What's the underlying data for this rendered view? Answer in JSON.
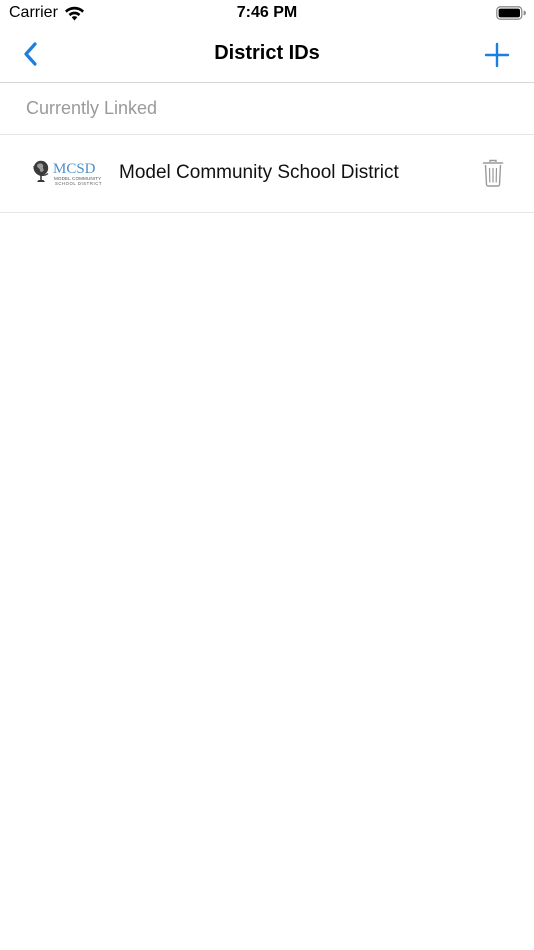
{
  "status_bar": {
    "carrier": "Carrier",
    "time": "7:46 PM",
    "wifi_icon": "wifi-icon",
    "battery_icon": "battery-icon"
  },
  "nav": {
    "title": "District IDs",
    "back_icon": "chevron-left-icon",
    "add_icon": "plus-icon"
  },
  "section": {
    "header": "Currently Linked"
  },
  "districts": [
    {
      "name": "Model Community School District",
      "logo": {
        "abbreviation": "MCSD",
        "line1": "MODEL COMMUNITY",
        "line2": "SCHOOL DISTRICT"
      },
      "delete_icon": "trash-icon"
    }
  ],
  "colors": {
    "accent": "#1a7fe0",
    "logo_text": "#4f8fc9",
    "section_header_text": "#9a9a9a",
    "separator": "#d8d8d8",
    "trash": "#9a9a9a"
  }
}
